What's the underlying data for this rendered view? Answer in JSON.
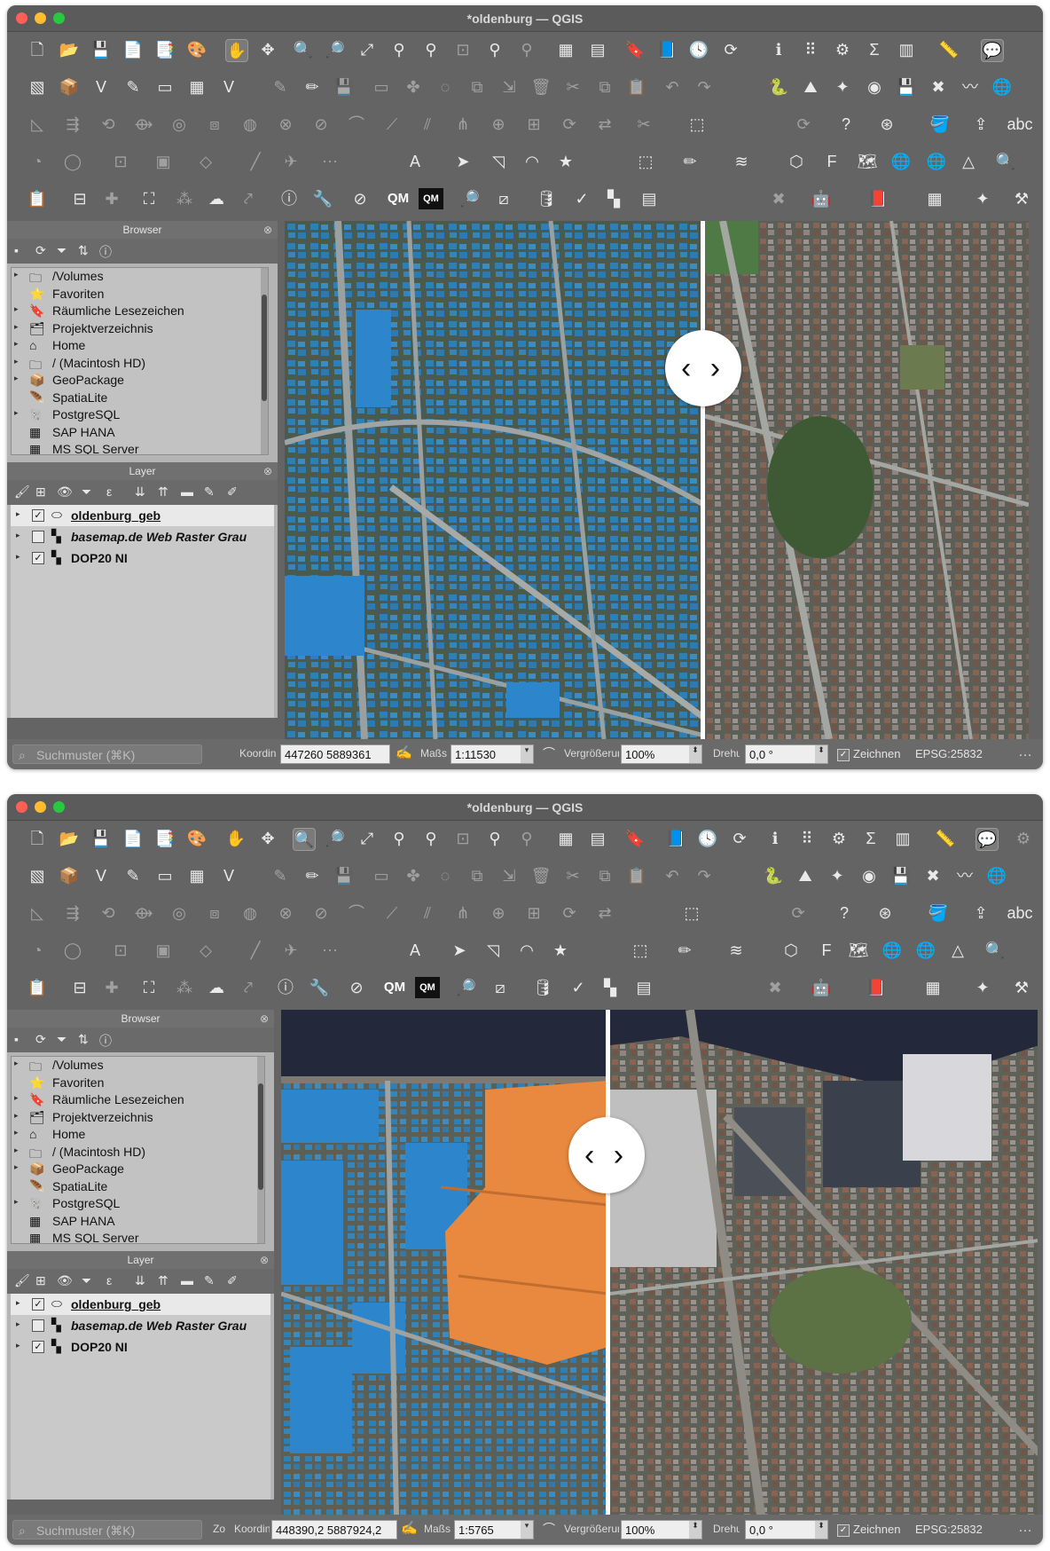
{
  "app": {
    "title": "*oldenburg — QGIS",
    "colors": {
      "window_bg": "#646464",
      "panel_bg": "#b4b4b4",
      "slider_white": "#ffffff",
      "building_blue": "#3a7fc8",
      "building_orange": "#e8893f"
    }
  },
  "browser": {
    "title": "Browser",
    "items": [
      {
        "label": "/Volumes",
        "icon": "folder-icon"
      },
      {
        "label": "Favoriten",
        "icon": "star-icon"
      },
      {
        "label": "Räumliche Lesezeichen",
        "icon": "bookmark-icon"
      },
      {
        "label": "Projektverzeichnis",
        "icon": "project-folder-icon"
      },
      {
        "label": "Home",
        "icon": "home-icon"
      },
      {
        "label": "/ (Macintosh HD)",
        "icon": "folder-icon"
      },
      {
        "label": "GeoPackage",
        "icon": "geopackage-icon"
      },
      {
        "label": "SpatiaLite",
        "icon": "spatialite-icon"
      },
      {
        "label": "PostgreSQL",
        "icon": "postgresql-icon"
      },
      {
        "label": "SAP HANA",
        "icon": "database-icon"
      },
      {
        "label": "MS SQL Server",
        "icon": "database-icon"
      }
    ]
  },
  "layers": {
    "title": "Layer",
    "items": [
      {
        "label": "oldenburg_geb",
        "checked": "✓",
        "icon": "polygon-layer-icon"
      },
      {
        "label": "basemap.de Web Raster Grau",
        "checked": "",
        "icon": "raster-layer-icon"
      },
      {
        "label": "DOP20 NI",
        "checked": "✓",
        "icon": "raster-layer-icon"
      }
    ]
  },
  "statusbar": {
    "search_placeholder": "Suchmuster (⌘K)",
    "coord_label": "Koordinate",
    "scale_label": "Maßstab",
    "magnify_label": "Vergrößerung",
    "rotation_label": "Drehung",
    "render_label": "Zeichnen",
    "crs": "EPSG:25832",
    "message_icon": "…"
  },
  "screens": [
    {
      "id": "a",
      "coordinate": "447260 5889361",
      "scale": "1:11530",
      "magnifier": "100%",
      "rotation": "0,0 °"
    },
    {
      "id": "b",
      "coordinate": "448390,2 5887924,2",
      "scale": "1:5765",
      "magnifier": "100%",
      "rotation": "0,0 °"
    }
  ],
  "slider": {
    "handle_label": "‹ ›"
  },
  "toolbar": {
    "qm_label": "QM",
    "qm_box_label": "QM"
  }
}
